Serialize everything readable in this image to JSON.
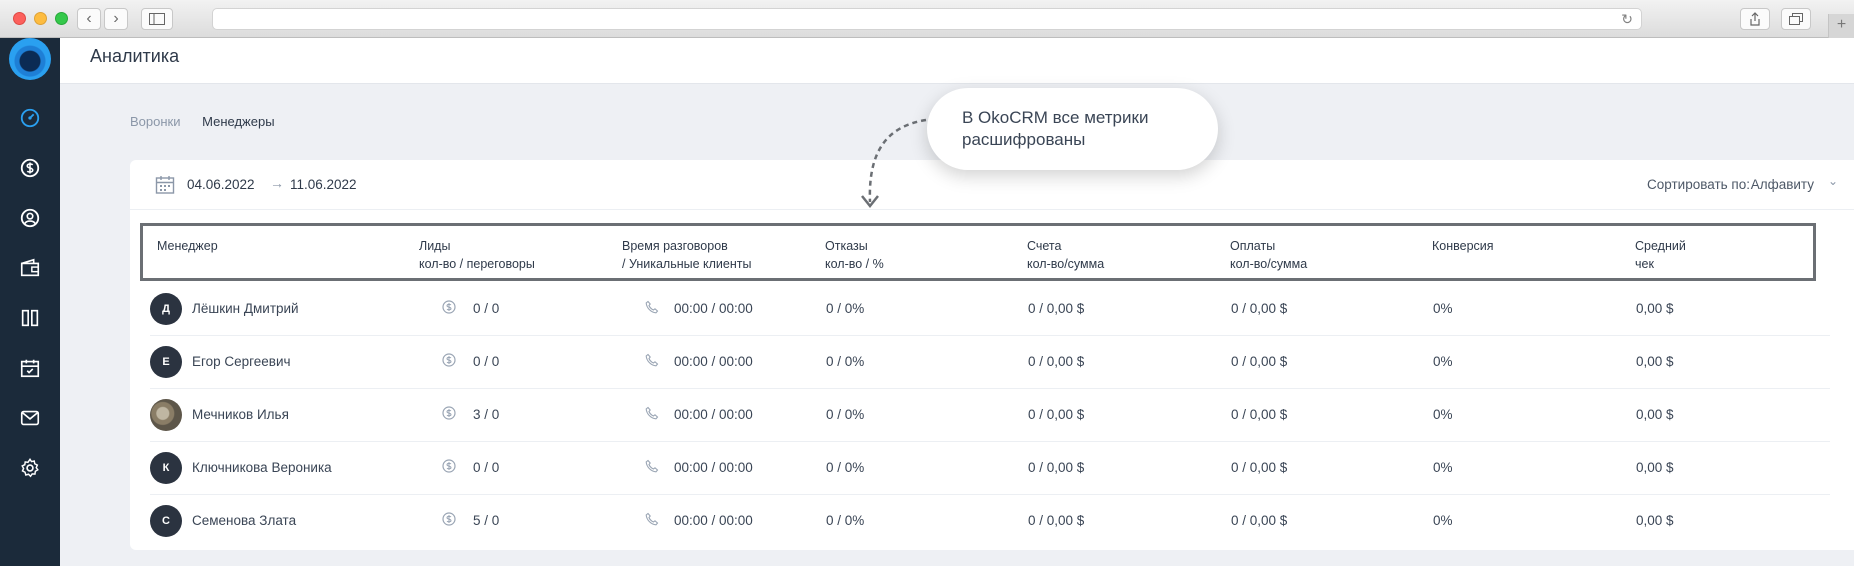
{
  "header": {
    "title": "Аналитика"
  },
  "breadcrumbs": [
    {
      "label": "Воронки",
      "active": false
    },
    {
      "label": "Менеджеры",
      "active": true
    }
  ],
  "filters": {
    "date_from": "04.06.2022",
    "date_to": "11.06.2022",
    "sort_label": "Сортировать по:",
    "sort_value": "Алфавиту"
  },
  "callout": {
    "text": "В OkoCRM все метрики расшифрованы"
  },
  "table": {
    "columns": [
      {
        "title": "Менеджер",
        "sub": ""
      },
      {
        "title": "Лиды",
        "sub": "кол-во / переговоры"
      },
      {
        "title": "Время разговоров",
        "sub": "/ Уникальные клиенты"
      },
      {
        "title": "Отказы",
        "sub": "кол-во / %"
      },
      {
        "title": "Счета",
        "sub": "кол-во/сумма"
      },
      {
        "title": "Оплаты",
        "sub": "кол-во/сумма"
      },
      {
        "title": "Конверсия",
        "sub": ""
      },
      {
        "title": "Средний",
        "sub": "чек"
      }
    ],
    "rows": [
      {
        "initial": "Д",
        "name": "Лёшкин Дмитрий",
        "leads": "0 / 0",
        "talk": "00:00 / 00:00",
        "refusals": "0 / 0%",
        "invoices": "0 / 0,00 $",
        "payments": "0 / 0,00 $",
        "conversion": "0%",
        "avg_check": "0,00 $"
      },
      {
        "initial": "Е",
        "name": "Егор Сергеевич",
        "leads": "0 / 0",
        "talk": "00:00 / 00:00",
        "refusals": "0 / 0%",
        "invoices": "0 / 0,00 $",
        "payments": "0 / 0,00 $",
        "conversion": "0%",
        "avg_check": "0,00 $"
      },
      {
        "initial": "",
        "name": "Мечников Илья",
        "leads": "3 / 0",
        "talk": "00:00 / 00:00",
        "refusals": "0 / 0%",
        "invoices": "0 / 0,00 $",
        "payments": "0 / 0,00 $",
        "conversion": "0%",
        "avg_check": "0,00 $"
      },
      {
        "initial": "К",
        "name": "Ключникова Вероника",
        "leads": "0 / 0",
        "talk": "00:00 / 00:00",
        "refusals": "0 / 0%",
        "invoices": "0 / 0,00 $",
        "payments": "0 / 0,00 $",
        "conversion": "0%",
        "avg_check": "0,00 $"
      },
      {
        "initial": "С",
        "name": "Семенова Злата",
        "leads": "5 / 0",
        "talk": "00:00 / 00:00",
        "refusals": "0 / 0%",
        "invoices": "0 / 0,00 $",
        "payments": "0 / 0,00 $",
        "conversion": "0%",
        "avg_check": "0,00 $"
      }
    ]
  },
  "icons": {
    "sidebar": [
      "dashboard-icon",
      "dollar-icon",
      "user-icon",
      "wallet-icon",
      "kanban-icon",
      "calendar-check-icon",
      "mail-icon",
      "gear-icon"
    ],
    "row": [
      "dollar-icon",
      "phone-icon"
    ]
  },
  "colors": {
    "sidebar_bg": "#1b2a3a",
    "accent": "#2aa0f0",
    "page_bg": "#eef0f4"
  }
}
